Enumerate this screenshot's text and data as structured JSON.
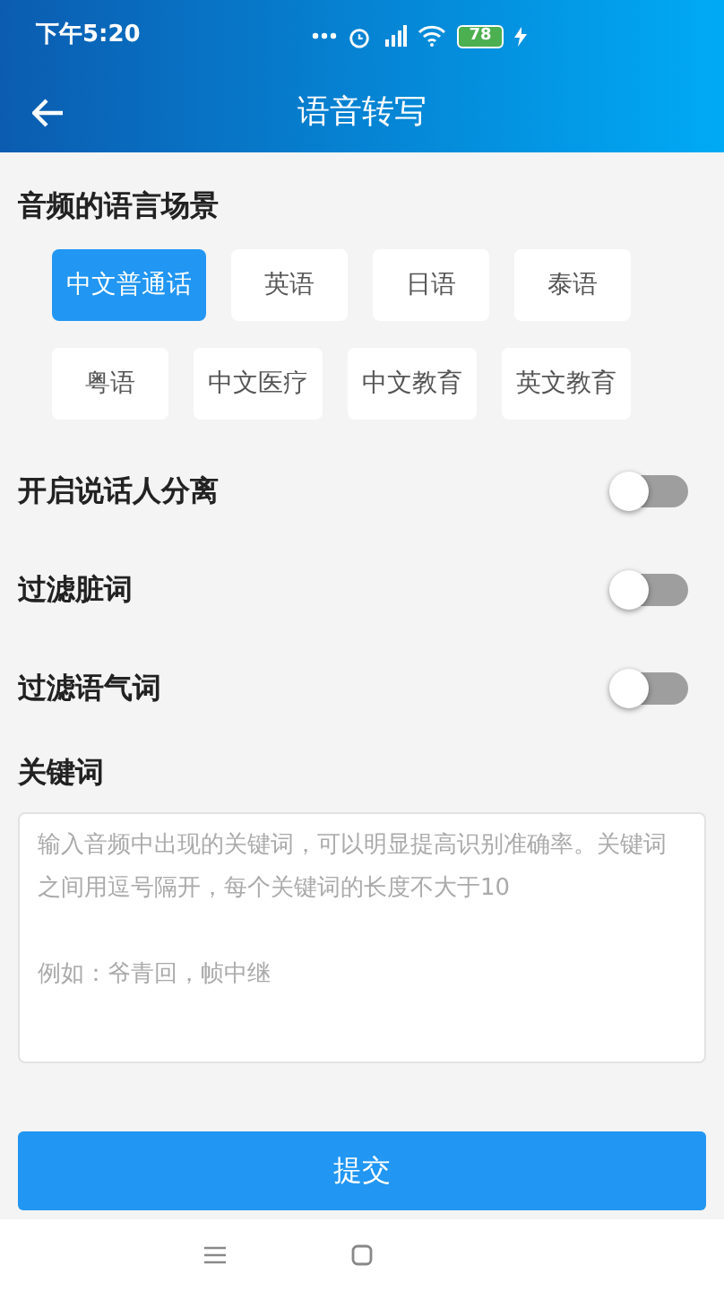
{
  "status_bar": {
    "time": "下午5:20",
    "battery": "78"
  },
  "header": {
    "title": "语音转写"
  },
  "language": {
    "title": "音频的语言场景",
    "options": [
      {
        "label": "中文普通话",
        "selected": true
      },
      {
        "label": "英语",
        "selected": false
      },
      {
        "label": "日语",
        "selected": false
      },
      {
        "label": "泰语",
        "selected": false
      },
      {
        "label": "粤语",
        "selected": false
      },
      {
        "label": "中文医疗",
        "selected": false
      },
      {
        "label": "中文教育",
        "selected": false
      },
      {
        "label": "英文教育",
        "selected": false
      }
    ]
  },
  "settings": [
    {
      "label": "开启说话人分离",
      "on": false
    },
    {
      "label": "过滤脏词",
      "on": false
    },
    {
      "label": "过滤语气词",
      "on": false
    }
  ],
  "keywords": {
    "title": "关键词",
    "placeholder": "输入音频中出现的关键词，可以明显提高识别准确率。关键词之间用逗号隔开，每个关键词的长度不大于10\n\n例如：爷青回，帧中继"
  },
  "submit": "提交"
}
